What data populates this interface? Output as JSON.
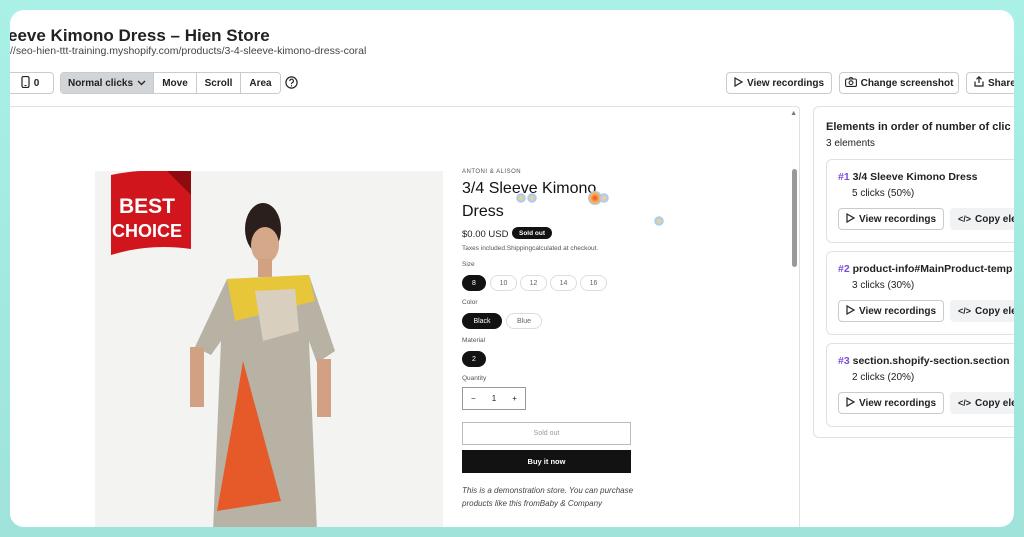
{
  "header": {
    "title": "eeve Kimono Dress – Hien Store",
    "url": "//seo-hien-ttt-training.myshopify.com/products/3-4-sleeve-kimono-dress-coral"
  },
  "toolbar": {
    "device_count": "0",
    "modes": [
      {
        "label": "Normal clicks",
        "icon": "chevron-down-icon",
        "active": true
      },
      {
        "label": "Move"
      },
      {
        "label": "Scroll"
      },
      {
        "label": "Area"
      }
    ],
    "help_icon": "question-circle-icon",
    "view_recordings": "View recordings",
    "change_screenshot": "Change screenshot",
    "share": "Share"
  },
  "store": {
    "ribbon": [
      "BEST",
      "CHOICE"
    ],
    "vendor": "ANTONI & ALISON",
    "product_title": "3/4 Sleeve Kimono Dress",
    "price": "$0.00 USD",
    "badge": "Sold out",
    "tax_note": "Taxes included.Shippingcalculated at checkout.",
    "size_label": "Size",
    "sizes": [
      "8",
      "10",
      "12",
      "14",
      "16"
    ],
    "color_label": "Color",
    "colors": [
      "Black",
      "Blue"
    ],
    "material_label": "Material",
    "materials": [
      "2"
    ],
    "quantity_label": "Quantity",
    "quantity_minus": "−",
    "quantity_value": "1",
    "quantity_plus": "+",
    "sold_out_button": "Sold out",
    "buy_button": "Buy it now",
    "description": "This is a demonstration store. You can purchase products like this fromBaby & Company"
  },
  "panel": {
    "title": "Elements in order of number of clic",
    "count": "3 elements",
    "items": [
      {
        "num": "#1",
        "name": "3/4 Sleeve Kimono Dress",
        "clicks": "5 clicks (50%)",
        "view": "View recordings",
        "copy": "Copy ele"
      },
      {
        "num": "#2",
        "name": "product-info#MainProduct-temp",
        "clicks": "3 clicks (30%)",
        "view": "View recordings",
        "copy": "Copy ele"
      },
      {
        "num": "#3",
        "name": "section.shopify-section.section",
        "clicks": "2 clicks (20%)",
        "view": "View recordings",
        "copy": "Copy ele"
      }
    ]
  },
  "colors": {
    "accent_number": "#7c4ddb",
    "ribbon_red": "#d0161c",
    "button_dark": "#121212",
    "frame_bg": "#a9f0e6"
  }
}
